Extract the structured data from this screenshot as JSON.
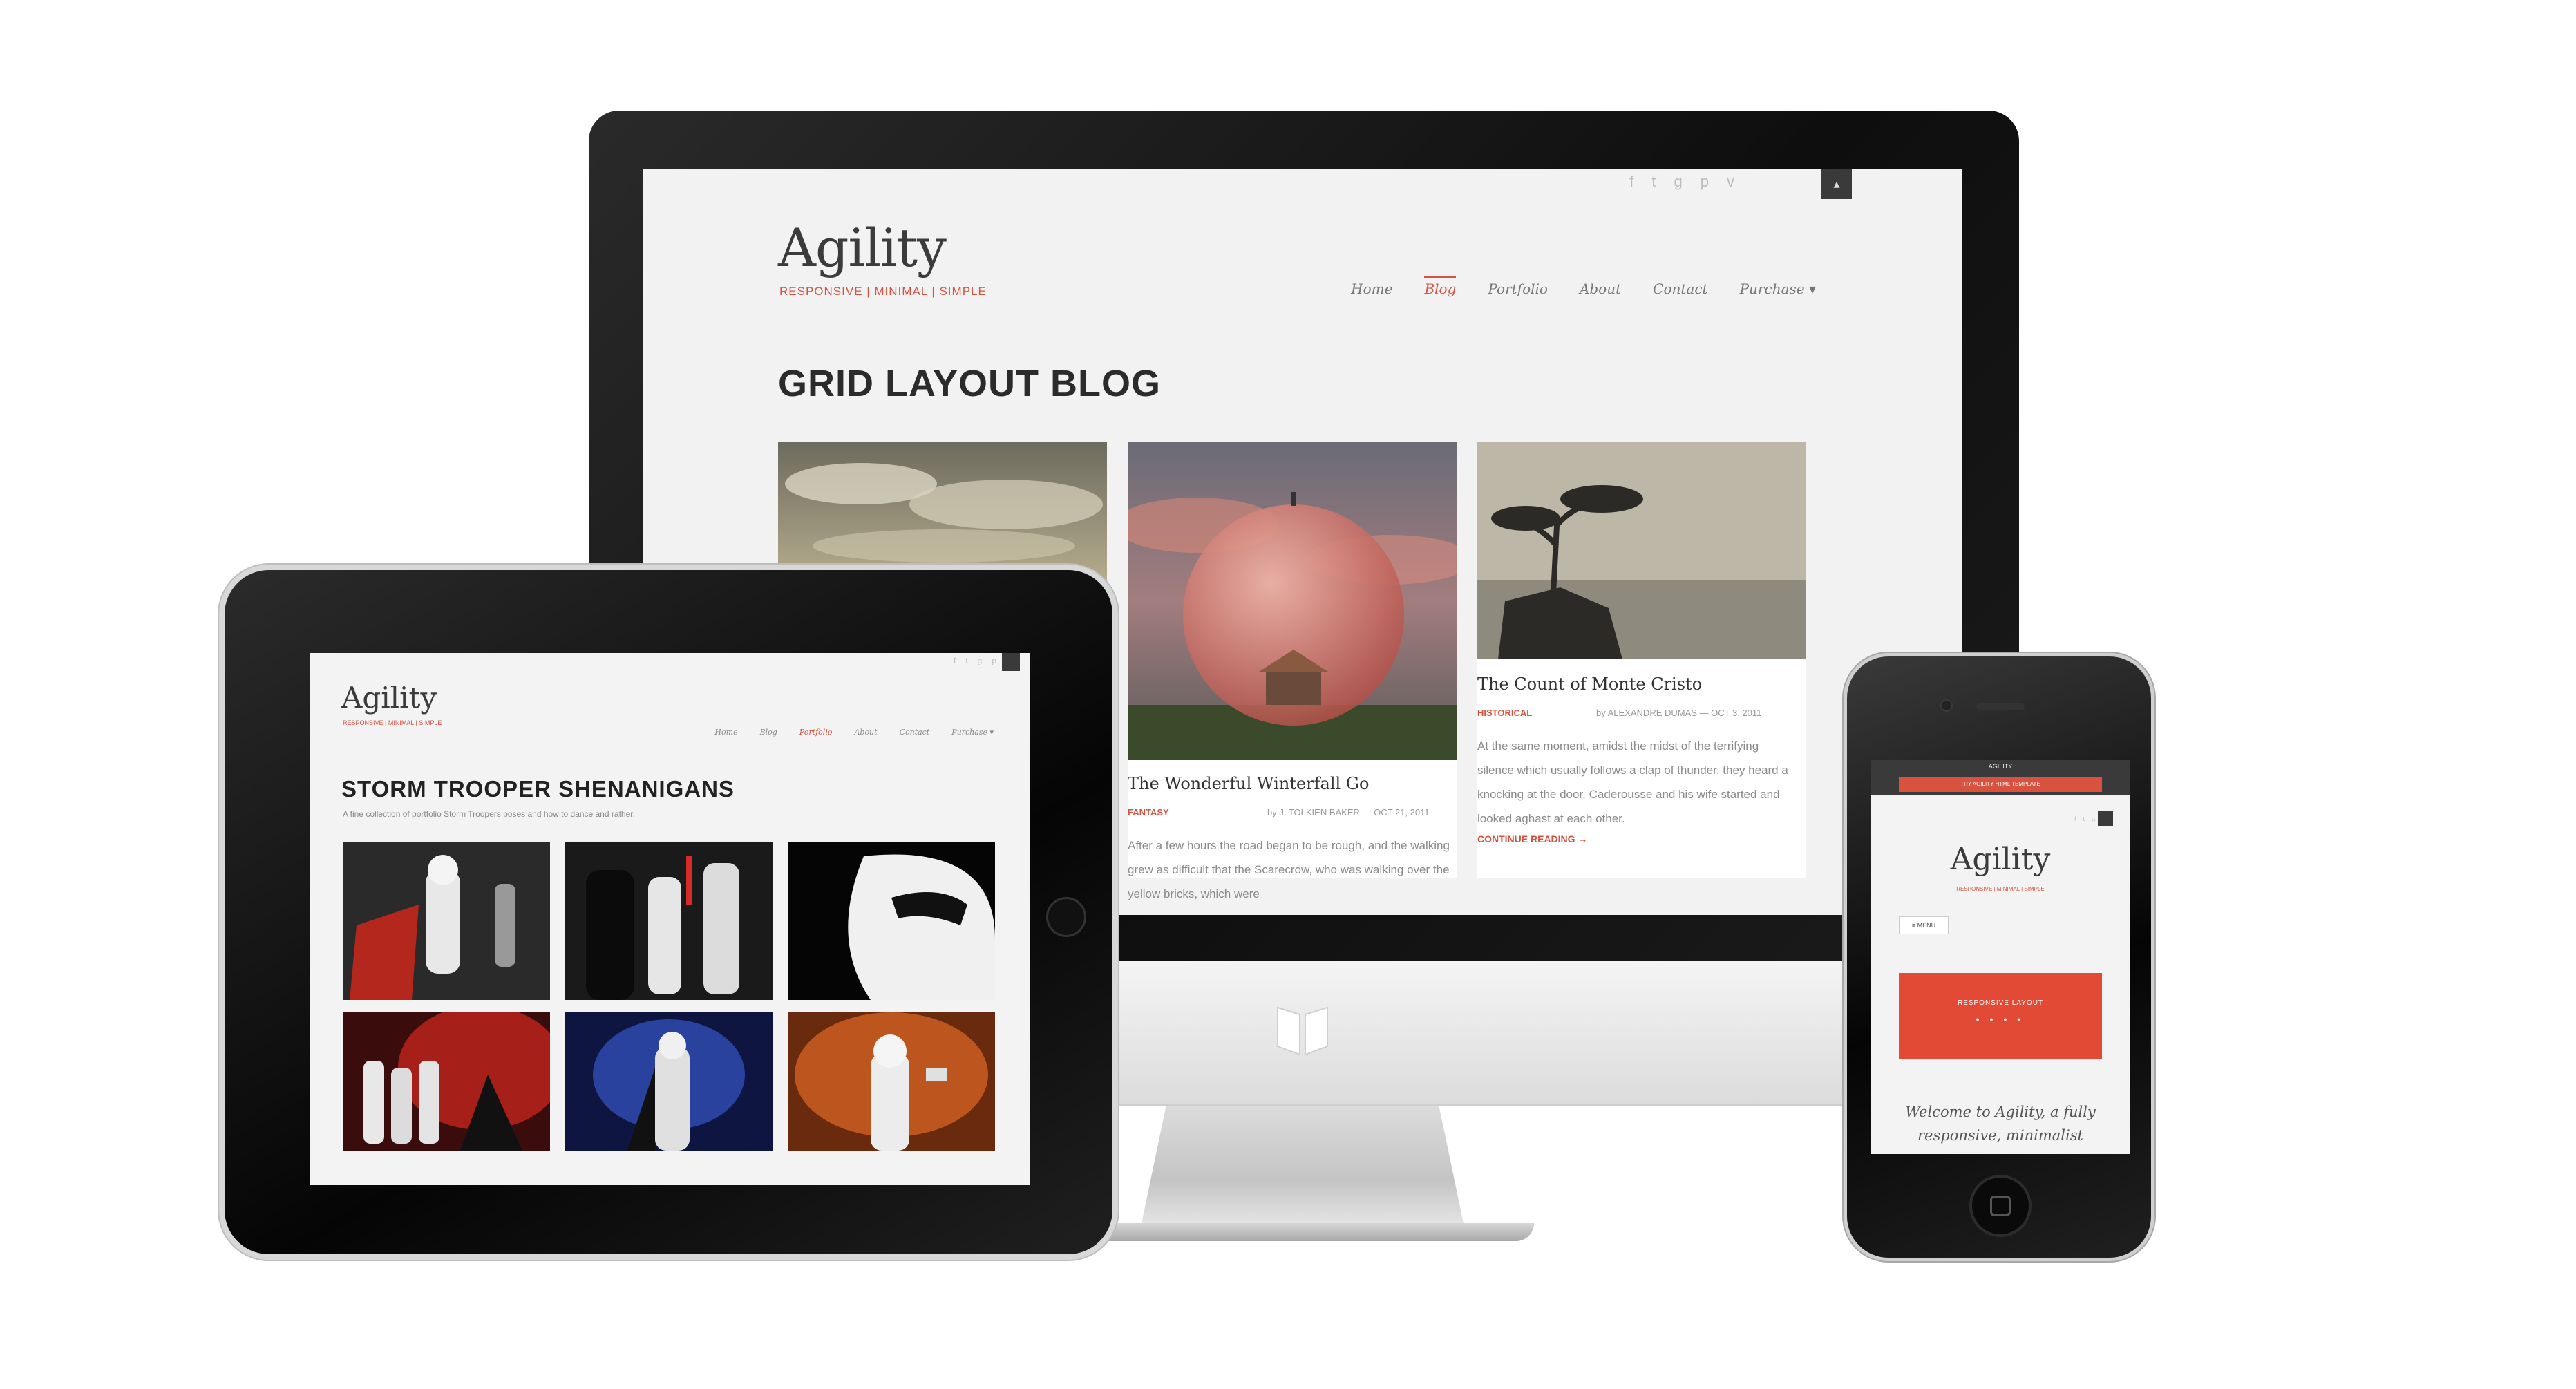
{
  "desktop": {
    "logo": "Agility",
    "tagline": "RESPONSIVE | MINIMAL | SIMPLE",
    "social_icons": [
      "facebook-icon",
      "twitter-icon",
      "google-plus-icon",
      "pinterest-icon",
      "vimeo-icon"
    ],
    "nav": [
      "Home",
      "Blog",
      "Portfolio",
      "About",
      "Contact",
      "Purchase ▾"
    ],
    "active_nav": "Blog",
    "page_heading": "GRID LAYOUT BLOG",
    "posts": [
      {
        "title": "The Wonderful Winterfall Go",
        "category": "FANTASY",
        "meta": "by J. TOLKIEN BAKER — OCT 21, 2011",
        "excerpt": "After a few hours the road began to be rough, and the walking grew as difficult that the Scarecrow, who was walking over the yellow bricks, which were"
      },
      {
        "title": "The Count of Monte Cristo",
        "category": "HISTORICAL",
        "meta": "by ALEXANDRE DUMAS — OCT 3, 2011",
        "excerpt": "At the same moment, amidst the midst of the terrifying silence which usually follows a clap of thunder, they heard a knocking at the door. Caderousse and his wife started and looked aghast at each other.",
        "read_more": "CONTINUE READING →"
      }
    ]
  },
  "tablet": {
    "logo": "Agility",
    "tagline": "RESPONSIVE | MINIMAL | SIMPLE",
    "nav": [
      "Home",
      "Blog",
      "Portfolio",
      "About",
      "Contact",
      "Purchase ▾"
    ],
    "active_nav": "Portfolio",
    "title": "STORM TROOPER SHENANIGANS",
    "subtitle": "A fine collection of portfolio Storm Troopers poses and how to dance and rather.",
    "thumbnails": [
      "thumb-trooper-red-cape",
      "thumb-vader-group",
      "thumb-helmet-closeup",
      "thumb-troopers-red-light",
      "thumb-blue-trooper",
      "thumb-trooper-orange"
    ]
  },
  "phone": {
    "top_label": "AGILITY",
    "top_button": "TRY AGILITY HTML TEMPLATE",
    "logo": "Agility",
    "tagline": "RESPONSIVE | MINIMAL | SIMPLE",
    "menu_button": "≡ MENU",
    "banner_title": "RESPONSIVE LAYOUT",
    "banner_dots": "● ● ● ●",
    "welcome": "Welcome to Agility, a fully responsive, minimalist"
  },
  "colors": {
    "accent": "#d9513f",
    "bezel": "#111111",
    "screen_bg": "#f2f2f2"
  }
}
